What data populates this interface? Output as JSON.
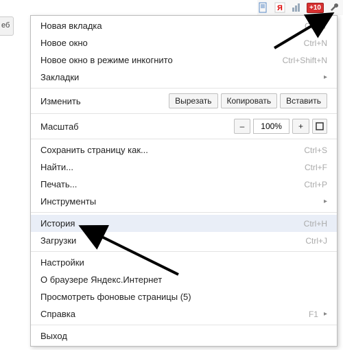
{
  "tab_stub": "еб",
  "toolbar": {
    "ext_badge": "+10"
  },
  "menu": {
    "new_tab": {
      "label": "Новая вкладка",
      "shortcut": "Ctrl+T"
    },
    "new_window": {
      "label": "Новое окно",
      "shortcut": "Ctrl+N"
    },
    "incognito": {
      "label": "Новое окно в режиме инкогнито",
      "shortcut": "Ctrl+Shift+N"
    },
    "bookmarks": {
      "label": "Закладки"
    },
    "edit": {
      "label": "Изменить",
      "cut": "Вырезать",
      "copy": "Копировать",
      "paste": "Вставить"
    },
    "zoom": {
      "label": "Масштаб",
      "minus": "–",
      "value": "100%",
      "plus": "+"
    },
    "save_as": {
      "label": "Сохранить страницу как...",
      "shortcut": "Ctrl+S"
    },
    "find": {
      "label": "Найти...",
      "shortcut": "Ctrl+F"
    },
    "print": {
      "label": "Печать...",
      "shortcut": "Ctrl+P"
    },
    "tools": {
      "label": "Инструменты"
    },
    "history": {
      "label": "История",
      "shortcut": "Ctrl+H"
    },
    "downloads": {
      "label": "Загрузки",
      "shortcut": "Ctrl+J"
    },
    "settings": {
      "label": "Настройки"
    },
    "about": {
      "label": "О браузере Яндекс.Интернет"
    },
    "bg_pages": {
      "label": "Просмотреть фоновые страницы (5)"
    },
    "help": {
      "label": "Справка",
      "shortcut": "F1"
    },
    "exit": {
      "label": "Выход"
    }
  }
}
